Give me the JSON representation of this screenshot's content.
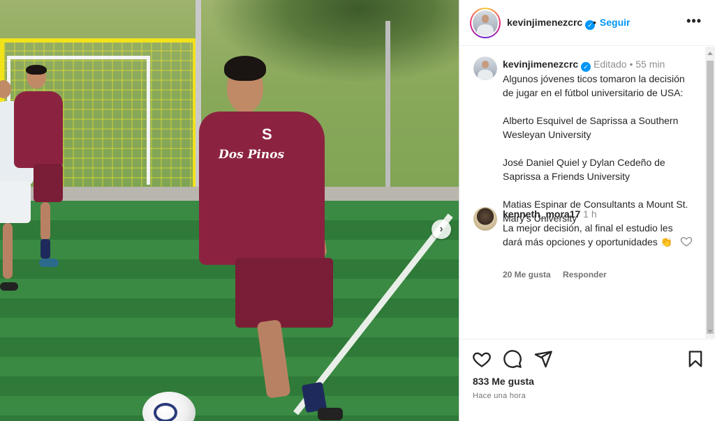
{
  "header": {
    "username": "kevinjimenezcrc",
    "verified_icon": "verified-badge-icon",
    "separator": "•",
    "follow_label": "Seguir",
    "more_icon": "more-options-icon",
    "more_glyph": "•••"
  },
  "media": {
    "next_icon": "chevron-right-icon",
    "next_glyph": "›",
    "sponsor_text": "Dos Pinos",
    "chest_letter": "S"
  },
  "caption": {
    "username": "kevinjimenezcrc",
    "edited": "Editado",
    "separator": "•",
    "age": "55 min",
    "text": "Algunos jóvenes ticos tomaron la decisión de jugar en el fútbol universitario de USA:\n\nAlberto Esquivel de Saprissa a Southern Wesleyan University\n\nJosé Daniel Quiel y Dylan Cedeño de Saprissa a Friends University\n\nMatias Espinar de Consultants a Mount St. Mary's University"
  },
  "comment": {
    "username": "kenneth_mora17",
    "age": "1 h",
    "text": "La mejor decisión, al final el estudio les dará más opciones y oportunidades 👏",
    "likes": "20 Me gusta",
    "reply_label": "Responder",
    "like_icon": "heart-outline-icon"
  },
  "footer": {
    "like_icon": "heart-icon",
    "comment_icon": "comment-icon",
    "share_icon": "send-icon",
    "save_icon": "bookmark-icon",
    "likes_count": "833 Me gusta",
    "timestamp": "Hace una hora"
  },
  "colors": {
    "accent": "#0095f6",
    "text": "#262626",
    "muted": "#8e8e8e",
    "jersey": "#8b2340"
  }
}
